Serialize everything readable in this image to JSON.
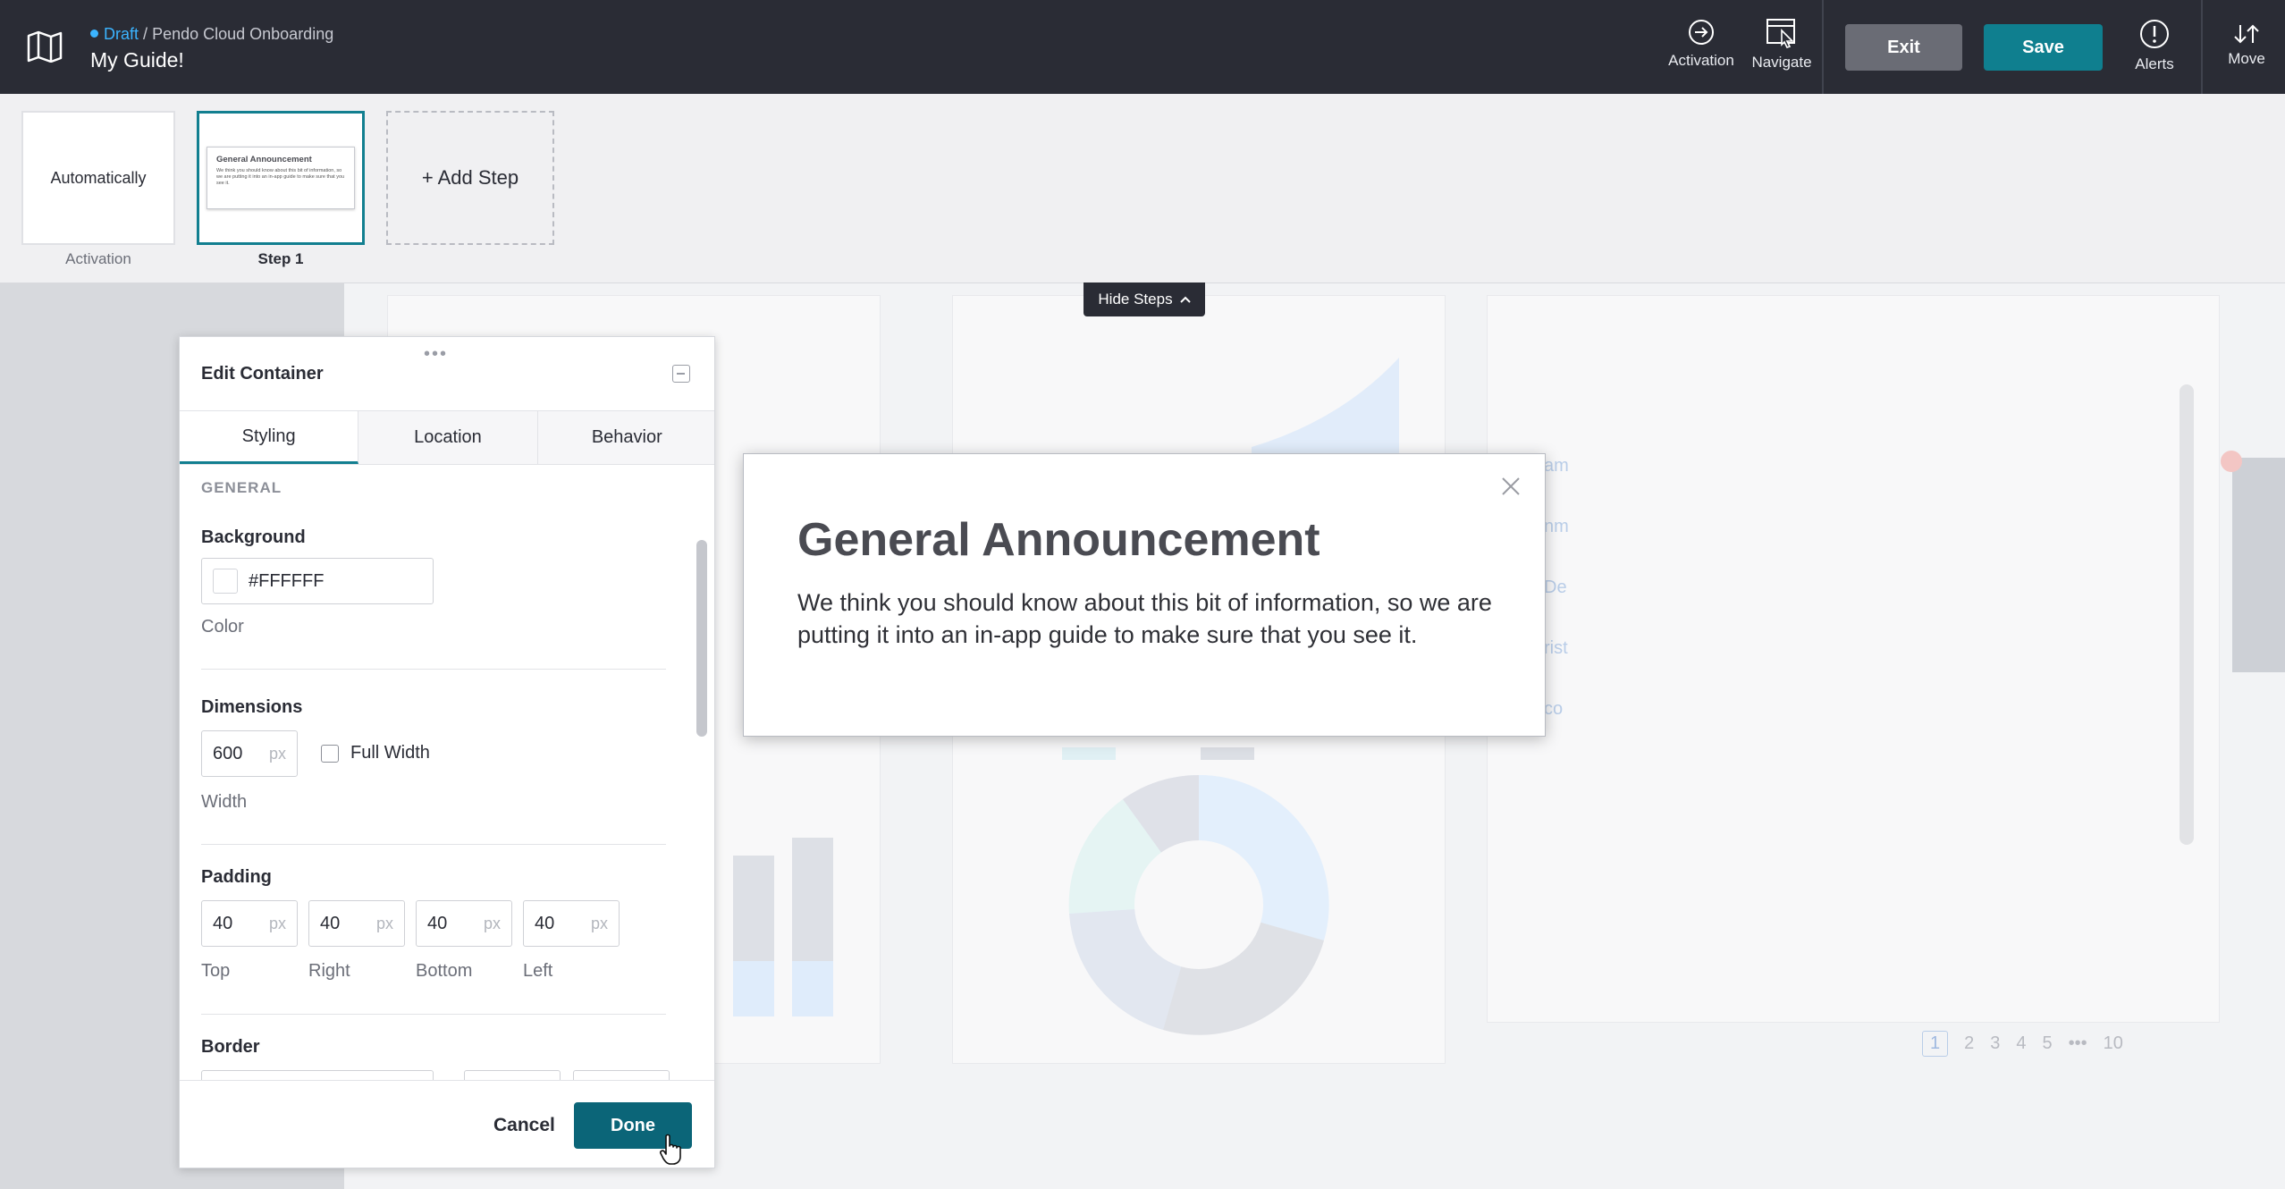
{
  "header": {
    "status": "Draft",
    "separator": "/",
    "app_name": "Pendo Cloud Onboarding",
    "guide_name": "My Guide!",
    "tools": [
      {
        "label": "Activation",
        "icon": "arrow-circle-icon"
      },
      {
        "label": "Navigate",
        "icon": "navigate-icon"
      },
      {
        "label": "Alerts",
        "icon": "alert-icon"
      },
      {
        "label": "Move",
        "icon": "move-arrows-icon"
      }
    ],
    "exit_label": "Exit",
    "save_label": "Save"
  },
  "steps": {
    "activation_card": "Automatically",
    "activation_label": "Activation",
    "step1_label": "Step 1",
    "step1_preview_title": "General Announcement",
    "step1_preview_body": "We think you should know about this bit of information, so we are putting it into an in-app guide to make sure that you see it.",
    "add_step": "+ Add Step",
    "hide_steps": "Hide Steps"
  },
  "panel": {
    "title": "Edit Container",
    "tabs": [
      "Styling",
      "Location",
      "Behavior"
    ],
    "active_tab": "Styling",
    "section": "GENERAL",
    "background_label": "Background",
    "background_value": "#FFFFFF",
    "color_label": "Color",
    "dimensions_label": "Dimensions",
    "width_value": "600",
    "unit": "px",
    "full_width_label": "Full Width",
    "width_label": "Width",
    "padding_label": "Padding",
    "padding": [
      {
        "value": "40",
        "label": "Top"
      },
      {
        "value": "40",
        "label": "Right"
      },
      {
        "value": "40",
        "label": "Bottom"
      },
      {
        "value": "40",
        "label": "Left"
      }
    ],
    "border_label": "Border",
    "cancel_label": "Cancel",
    "done_label": "Done"
  },
  "guide": {
    "title": "General Announcement",
    "body": "We think you should know about this bit of information, so we are putting it into an in-app guide to make sure that you see it."
  },
  "background_app": {
    "list_fragments": [
      "am",
      "nm",
      "De",
      "rist",
      "co"
    ],
    "pagination": [
      "1",
      "2",
      "3",
      "4",
      "5",
      "•••",
      "10"
    ]
  },
  "colors": {
    "topbar": "#2a2c35",
    "accent_teal": "#0f7f8f",
    "done_button": "#0b6578",
    "exit_button": "#6a6c75",
    "draft_blue": "#3bb4ff"
  }
}
